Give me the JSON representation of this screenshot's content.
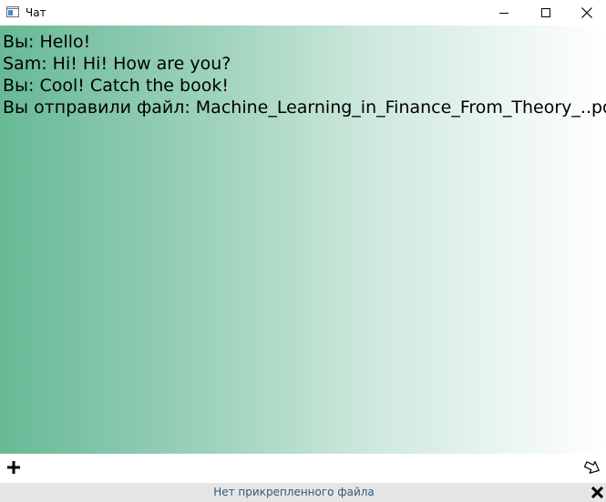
{
  "window": {
    "title": "Чат",
    "icons": {
      "app": "app-window-icon",
      "minimize": "minimize-icon",
      "maximize": "maximize-icon",
      "close": "close-icon"
    }
  },
  "chat": {
    "messages": [
      {
        "text": "Вы: Hello!"
      },
      {
        "text": "Sam: Hi! Hi! How are you?"
      },
      {
        "text": "Вы: Cool! Catch the book!"
      },
      {
        "text": "Вы отправили файл: Machine_Learning_in_Finance_From_Theory_..pdf"
      }
    ],
    "colors": {
      "gradient_start": "#67b996",
      "gradient_end": "#ffffff"
    }
  },
  "composer": {
    "attach_icon": "plus-icon",
    "input_value": "",
    "send_icon": "send-arrow-icon"
  },
  "status": {
    "text": "Нет прикрепленного файла",
    "clear_icon": "close-x-icon",
    "text_color": "#315a75"
  }
}
